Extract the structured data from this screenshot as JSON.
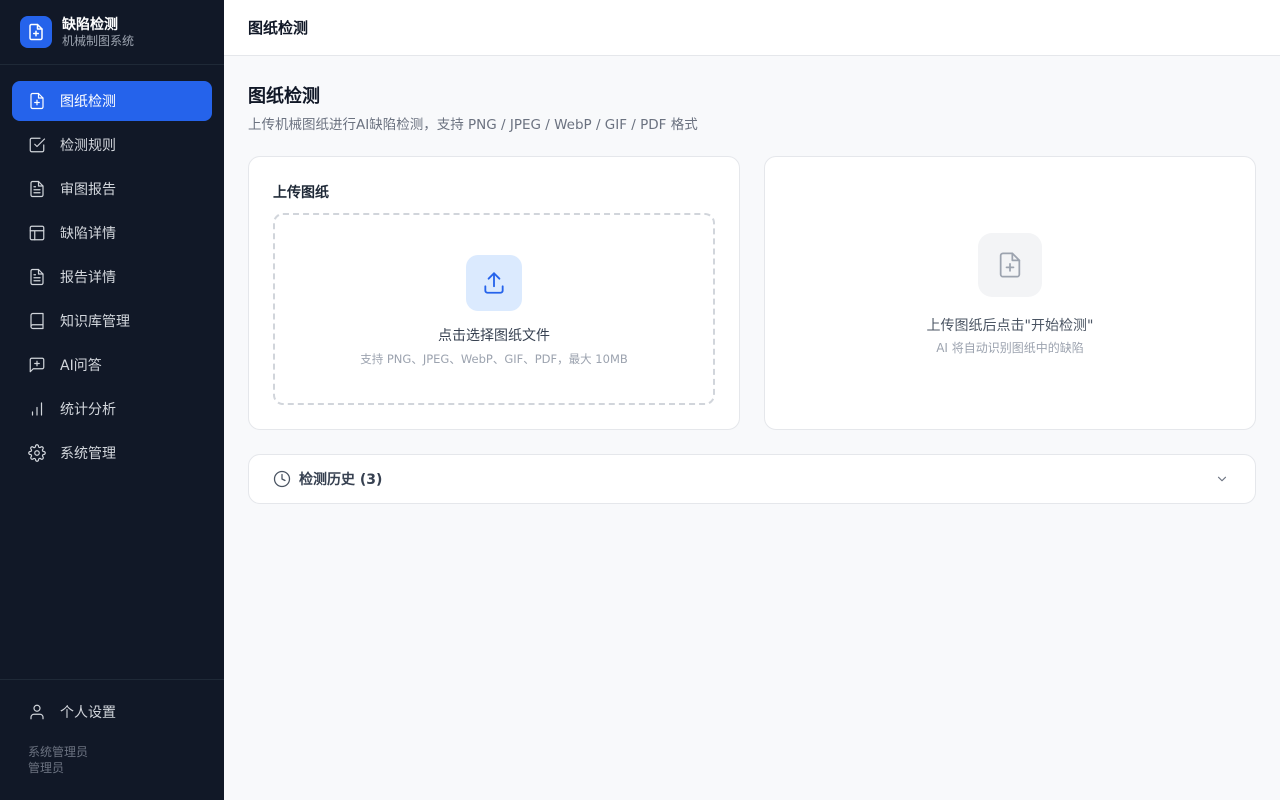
{
  "brand": {
    "title": "缺陷检测",
    "subtitle": "机械制图系统",
    "logo_icon": "file-plus-icon"
  },
  "sidebar": {
    "items": [
      {
        "label": "图纸检测",
        "icon": "file-plus-icon",
        "active": true
      },
      {
        "label": "检测规则",
        "icon": "check-square-icon",
        "active": false
      },
      {
        "label": "审图报告",
        "icon": "file-text-icon",
        "active": false
      },
      {
        "label": "缺陷详情",
        "icon": "layout-icon",
        "active": false
      },
      {
        "label": "报告详情",
        "icon": "file-text-icon",
        "active": false
      },
      {
        "label": "知识库管理",
        "icon": "book-icon",
        "active": false
      },
      {
        "label": "AI问答",
        "icon": "message-plus-icon",
        "active": false
      },
      {
        "label": "统计分析",
        "icon": "bar-chart-icon",
        "active": false
      },
      {
        "label": "系统管理",
        "icon": "gear-icon",
        "active": false
      }
    ],
    "settings_label": "个人设置",
    "settings_icon": "user-icon",
    "user_name": "系统管理员",
    "user_role": "管理员"
  },
  "header": {
    "title": "图纸检测"
  },
  "main": {
    "title": "图纸检测",
    "subtitle": "上传机械图纸进行AI缺陷检测，支持 PNG / JPEG / WebP / GIF / PDF 格式",
    "upload": {
      "title": "上传图纸",
      "icon": "upload-icon",
      "prompt": "点击选择图纸文件",
      "hint": "支持 PNG、JPEG、WebP、GIF、PDF，最大 10MB"
    },
    "result": {
      "icon": "file-plus-icon",
      "message": "上传图纸后点击\"开始检测\"",
      "hint": "AI 将自动识别图纸中的缺陷"
    },
    "history": {
      "label": "检测历史 (3)",
      "icon": "clock-icon",
      "toggle_icon": "chevron-down-icon"
    }
  },
  "colors": {
    "sidebar_bg": "#111827",
    "accent": "#2563eb",
    "page_bg": "#f8f9fb"
  }
}
